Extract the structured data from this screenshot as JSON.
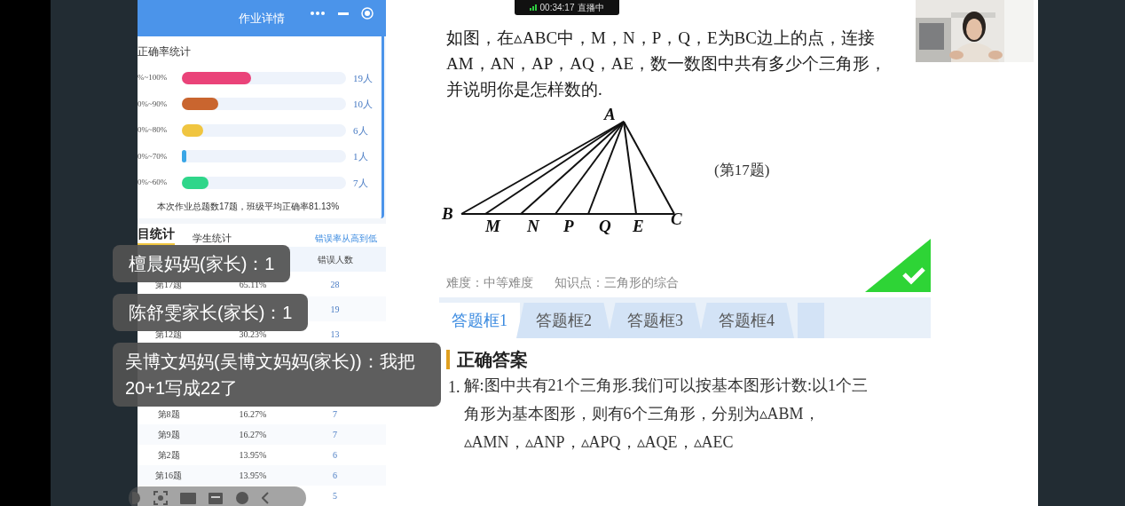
{
  "phone_panel": {
    "title": "作业详情",
    "accuracy_card": {
      "title": "正确率统计",
      "ranges": [
        {
          "label": "%~100%",
          "level": 0.42,
          "count": "19人",
          "color": "#ea4379"
        },
        {
          "label": "0%~90%",
          "level": 0.22,
          "count": "10人",
          "color": "#c9652f"
        },
        {
          "label": "0%~80%",
          "level": 0.13,
          "count": "6人",
          "color": "#f0c540"
        },
        {
          "label": "0%~70%",
          "level": 0.02,
          "count": "1人",
          "color": "#3aa6e6"
        },
        {
          "label": "0%~60%",
          "level": 0.16,
          "count": "7人",
          "color": "#2fd68a"
        }
      ],
      "summary": "本次作业总题数17题，班级平均正确率81.13%"
    },
    "tabs": [
      {
        "label": "目统计",
        "selected": true
      },
      {
        "label": "学生统计",
        "selected": false
      }
    ],
    "sort_link": "错误率从高到低",
    "table": {
      "count_header": "错误人数",
      "rows_top": [
        {
          "question": "第17题",
          "rate": "65.11%",
          "count": "28"
        },
        {
          "count": "19"
        },
        {
          "question": "第12题",
          "rate": "30.23%",
          "count": "13"
        }
      ],
      "rows_bottom": [
        {
          "question": "第8题",
          "rate": "16.27%",
          "count": "7"
        },
        {
          "question": "第9题",
          "rate": "16.27%",
          "count": "7"
        },
        {
          "question": "第2题",
          "rate": "13.95%",
          "count": "6"
        },
        {
          "question": "第16题",
          "rate": "13.95%",
          "count": "6"
        },
        {
          "count": "5"
        }
      ]
    }
  },
  "live_badge": {
    "time": "00:34:17",
    "status": "直播中"
  },
  "question": {
    "lines": [
      "如图，在▵ABC中，M，N，P，Q，E为BC边上的点，连接",
      "AM，AN，AP，AQ，AE，数一数图中共有多少个三角形，",
      "并说明你是怎样数的."
    ],
    "figure_points": [
      "A",
      "B",
      "M",
      "N",
      "P",
      "Q",
      "E",
      "C"
    ],
    "figure_caption": "(第17题)",
    "difficulty": "难度：中等难度",
    "knowledge": "知识点：三角形的综合",
    "correct": true
  },
  "answer_tabs": [
    {
      "label": "答题框1",
      "selected": true
    },
    {
      "label": "答题框2",
      "selected": false
    },
    {
      "label": "答题框3",
      "selected": false
    },
    {
      "label": "答题框4",
      "selected": false
    }
  ],
  "answer": {
    "title": "正确答案",
    "number": "1.",
    "lines": [
      "解:图中共有21个三角形.我们可以按基本图形计数:以1个三",
      "角形为基本图形，则有6个三角形，分别为▵ABM，",
      "▵AMN，▵ANP，▵APQ，▵AQE，▵AEC"
    ]
  },
  "chat_messages": [
    "檀晨妈妈(家长)：1",
    "陈舒雯家长(家长)：1",
    "吴博文妈妈(吴博文妈妈(家长))：我把20+1写成22了"
  ]
}
